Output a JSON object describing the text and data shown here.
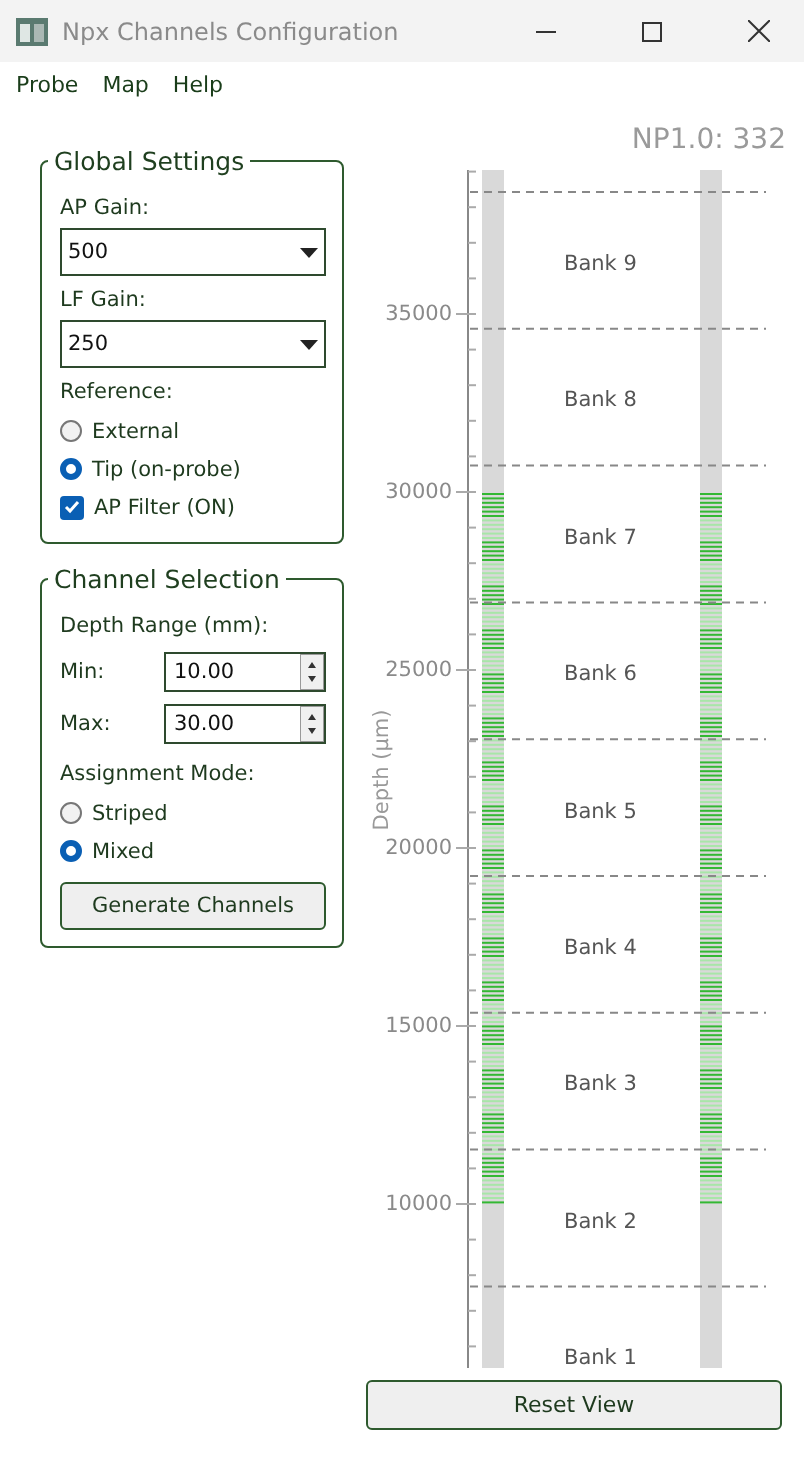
{
  "window": {
    "title": "Npx Channels Configuration"
  },
  "menu": [
    "Probe",
    "Map",
    "Help"
  ],
  "global_settings": {
    "title": "Global Settings",
    "ap_gain": {
      "label": "AP Gain:",
      "value": "500"
    },
    "lf_gain": {
      "label": "LF Gain:",
      "value": "250"
    },
    "reference": {
      "label": "Reference:",
      "options": [
        {
          "label": "External",
          "selected": false
        },
        {
          "label": "Tip (on-probe)",
          "selected": true
        }
      ]
    },
    "ap_filter": {
      "label": "AP Filter (ON)",
      "checked": true
    }
  },
  "channel_selection": {
    "title": "Channel Selection",
    "depth_label": "Depth Range (mm):",
    "min": {
      "label": "Min:",
      "value": "10.00"
    },
    "max": {
      "label": "Max:",
      "value": "30.00"
    },
    "mode": {
      "label": "Assignment Mode:",
      "options": [
        {
          "label": "Striped",
          "selected": false
        },
        {
          "label": "Mixed",
          "selected": true
        }
      ]
    },
    "button": "Generate Channels"
  },
  "probe_map": {
    "title": "NP1.0: 332",
    "axis_label": "Depth (µm)",
    "ticks": [
      "35000",
      "30000",
      "25000",
      "20000",
      "15000",
      "10000"
    ],
    "banks": [
      "Bank 9",
      "Bank 8",
      "Bank 7",
      "Bank 6",
      "Bank 5",
      "Bank 4",
      "Bank 3",
      "Bank 2",
      "Bank 1"
    ]
  },
  "reset_button": "Reset View"
}
